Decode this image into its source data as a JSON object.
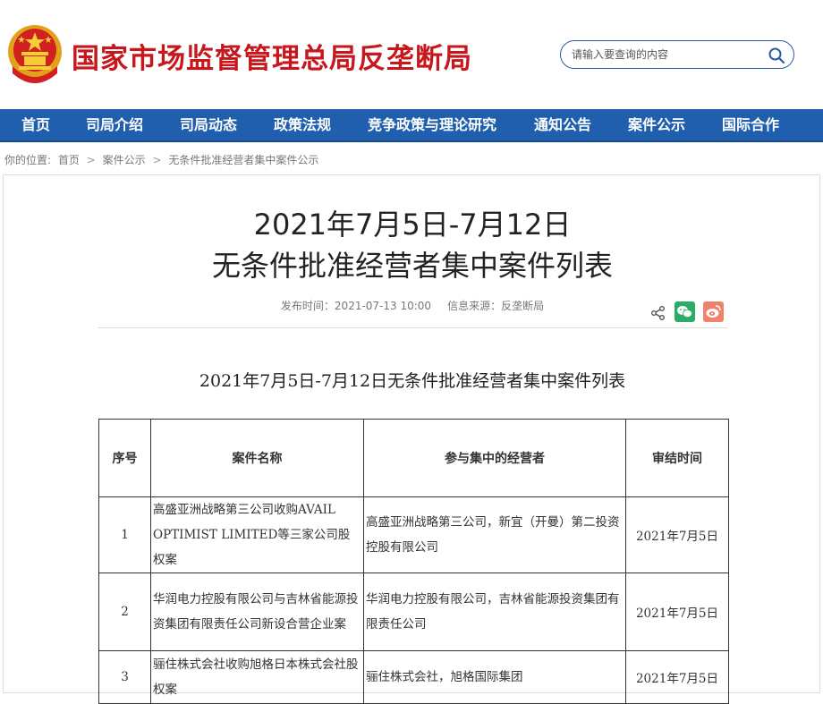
{
  "header": {
    "site_title": "国家市场监督管理总局反垄断局",
    "search_placeholder": "请输入要查询的内容"
  },
  "nav": [
    "首页",
    "司局介绍",
    "司局动态",
    "政策法规",
    "竞争政策与理论研究",
    "通知公告",
    "案件公示",
    "国际合作"
  ],
  "breadcrumb": {
    "prefix": "你的位置:",
    "items": [
      "首页",
      "案件公示",
      "无条件批准经营者集中案件公示"
    ],
    "separator": ">"
  },
  "article": {
    "title_line1": "2021年7月5日-7月12日",
    "title_line2": "无条件批准经营者集中案件列表",
    "publish_time": "发布时间：2021-07-13 10:00",
    "source": "信息来源：反垄断局",
    "subtitle": "2021年7月5日-7月12日无条件批准经营者集中案件列表"
  },
  "table": {
    "headers": [
      "序号",
      "案件名称",
      "参与集中的经营者",
      "审结时间"
    ],
    "rows": [
      [
        "1",
        "高盛亚洲战略第三公司收购AVAIL OPTIMIST LIMITED等三家公司股权案",
        "高盛亚洲战略第三公司，新宜（开曼）第二投资控股有限公司",
        "2021年7月5日"
      ],
      [
        "2",
        "华润电力控股有限公司与吉林省能源投资集团有限责任公司新设合营企业案",
        "华润电力控股有限公司，吉林省能源投资集团有限责任公司",
        "2021年7月5日"
      ],
      [
        "3",
        "骊住株式会社收购旭格日本株式会社股权案",
        "骊住株式会社，旭格国际集团",
        "2021年7月5日"
      ]
    ]
  },
  "icons": {
    "search": "search-icon",
    "share": "share-icon",
    "wechat": "wechat-icon",
    "weibo": "weibo-icon",
    "emblem": "national-emblem-icon"
  },
  "colors": {
    "brand_red": "#c8161d",
    "nav_blue": "#1f5fae",
    "wechat_green": "#2aae67",
    "weibo_red": "#f0816b"
  }
}
